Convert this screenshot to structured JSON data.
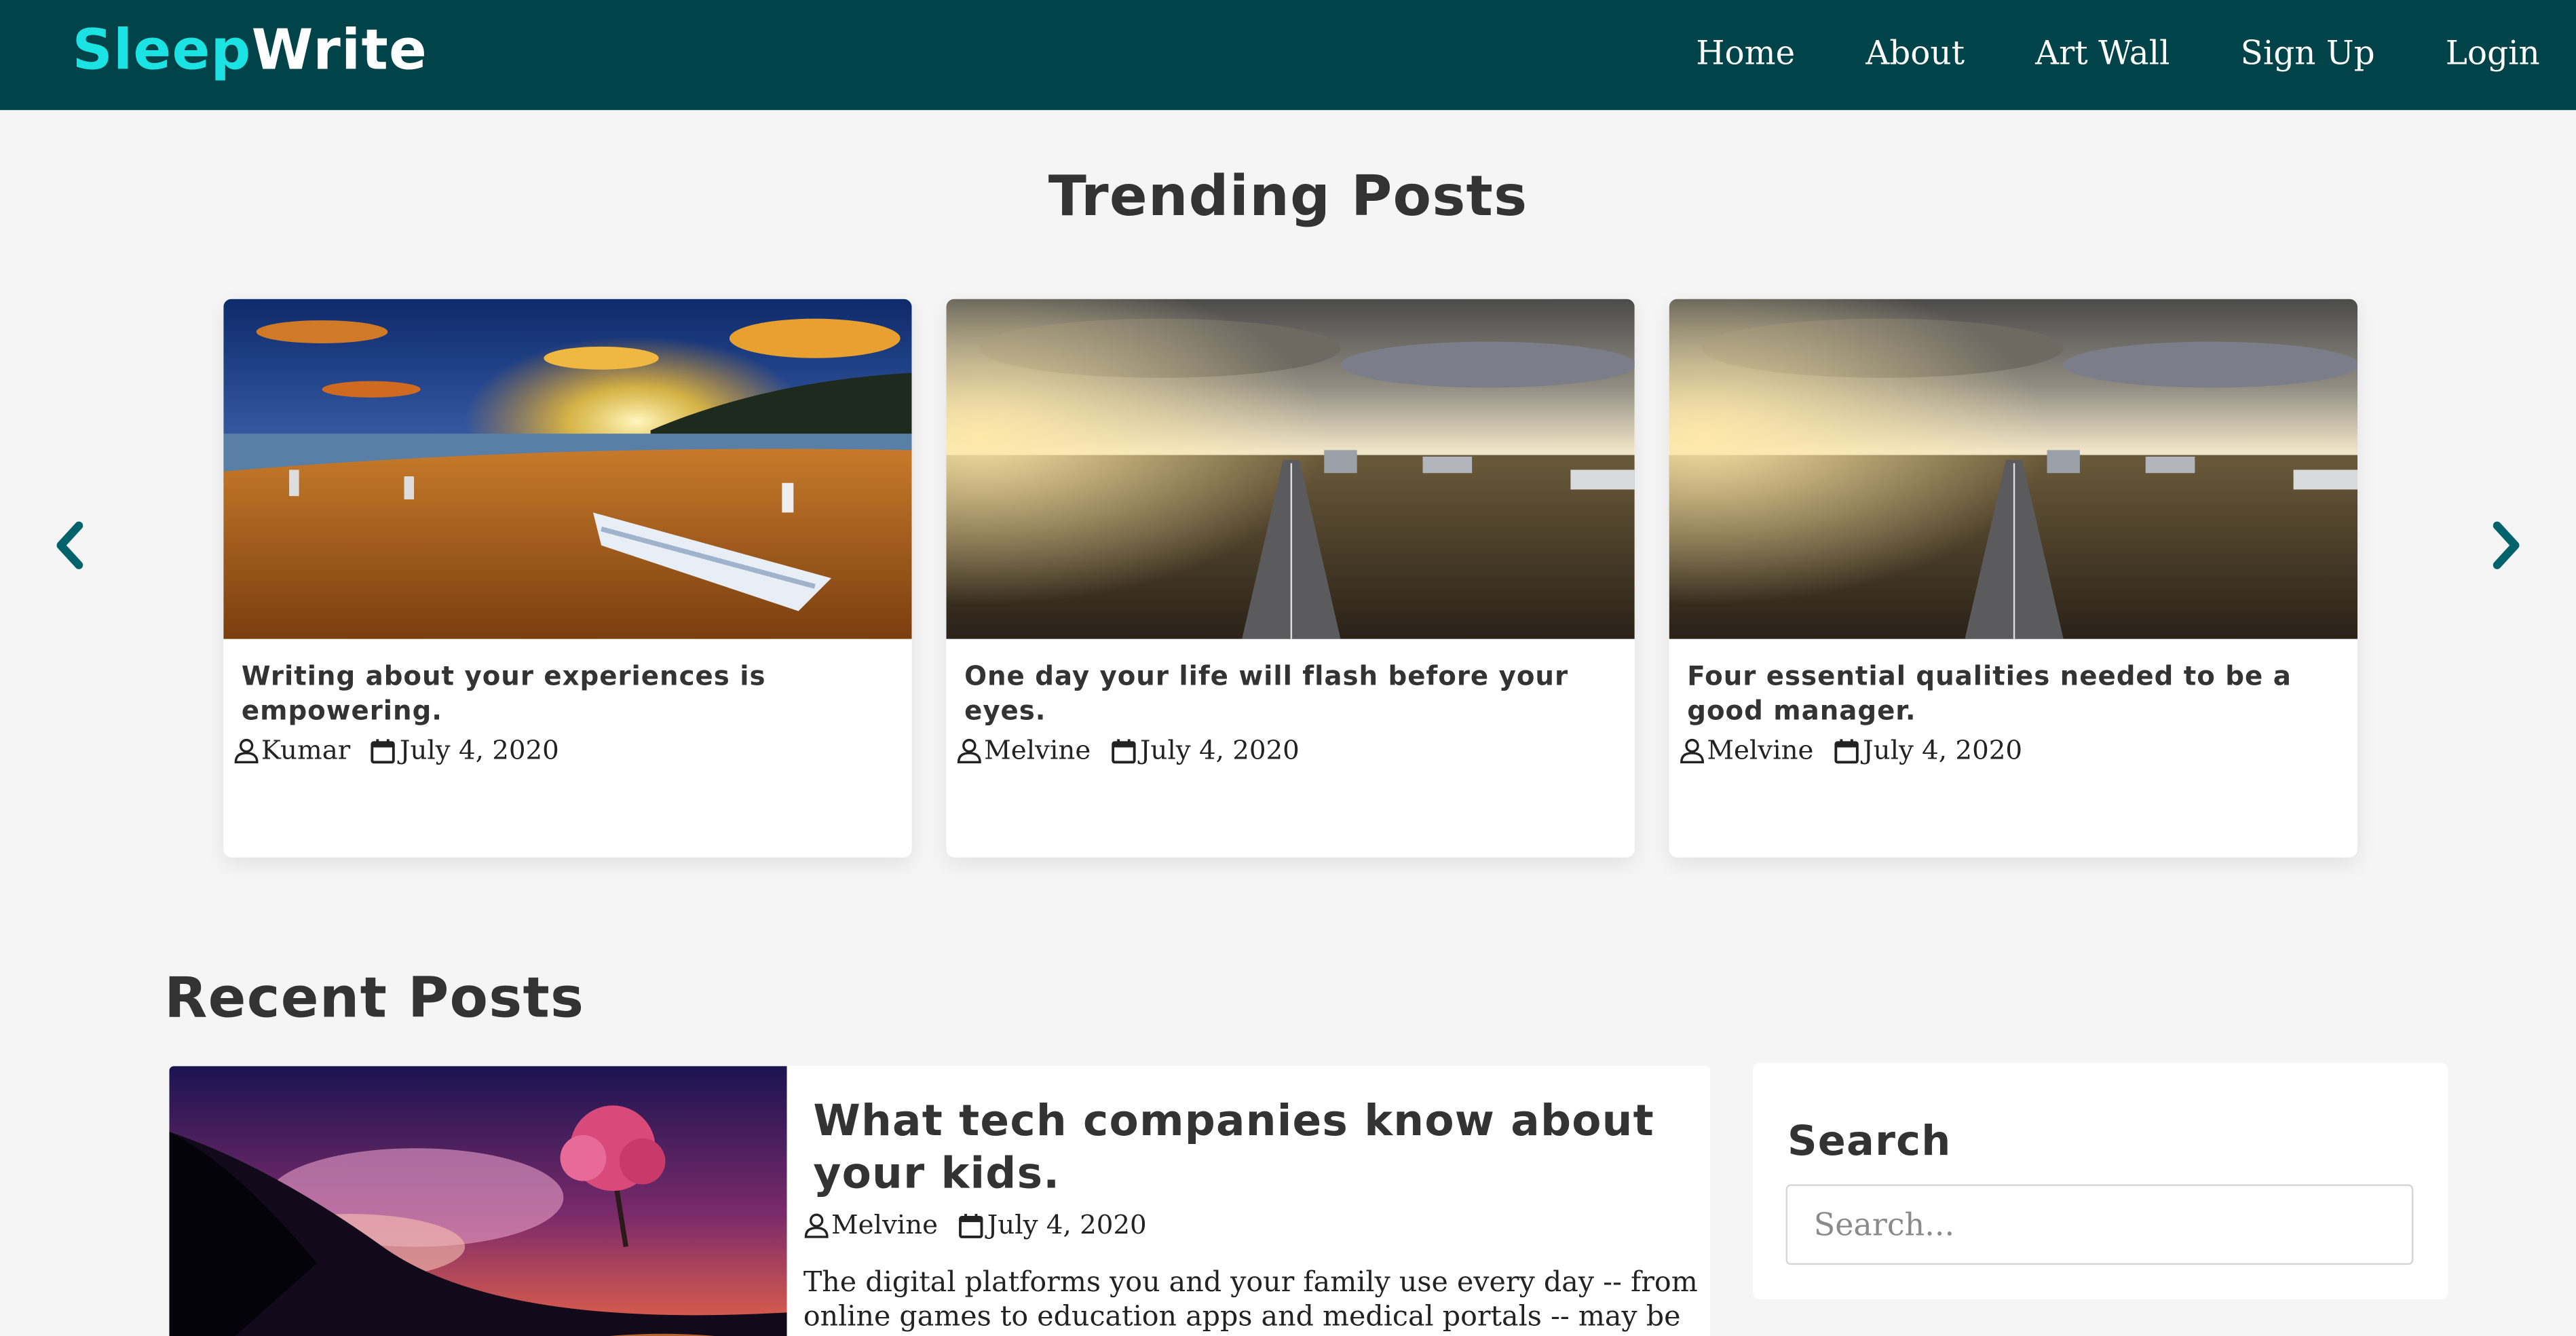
{
  "brand": {
    "part1": "Sleep",
    "part2": "Write",
    "colors": {
      "part1": "#1be3e3",
      "part2": "#ffffff",
      "navbar_bg": "#004349"
    }
  },
  "nav": {
    "items": [
      {
        "label": "Home"
      },
      {
        "label": "About"
      },
      {
        "label": "Art Wall"
      },
      {
        "label": "Sign Up"
      },
      {
        "label": "Login"
      }
    ]
  },
  "trending": {
    "title": "Trending Posts",
    "prev_icon": "chevron-left-icon",
    "next_icon": "chevron-right-icon",
    "arrow_color": "#00626a",
    "cards": [
      {
        "title": "Writing about your experiences is empowering.",
        "author": "Kumar",
        "date": "July 4, 2020",
        "image": "beach-sunset-boat"
      },
      {
        "title": "One day your life will flash before your eyes.",
        "author": "Melvine",
        "date": "July 4, 2020",
        "image": "city-avenue-sunrise"
      },
      {
        "title": "Four essential qualities needed to be a good manager.",
        "author": "Melvine",
        "date": "July 4, 2020",
        "image": "city-avenue-sunrise"
      }
    ]
  },
  "recent": {
    "title": "Recent Posts",
    "posts": [
      {
        "title": "What tech companies know about your kids.",
        "author": "Melvine",
        "date": "July 4, 2020",
        "excerpt": "The digital platforms you and your family use every day -- from online games to education apps and medical portals -- may be collecting and",
        "image": "fantasy-tree-sunset"
      }
    ]
  },
  "sidebar": {
    "search": {
      "title": "Search",
      "placeholder": "Search..."
    }
  },
  "icons": {
    "author": "user-icon",
    "date": "calendar-icon"
  }
}
